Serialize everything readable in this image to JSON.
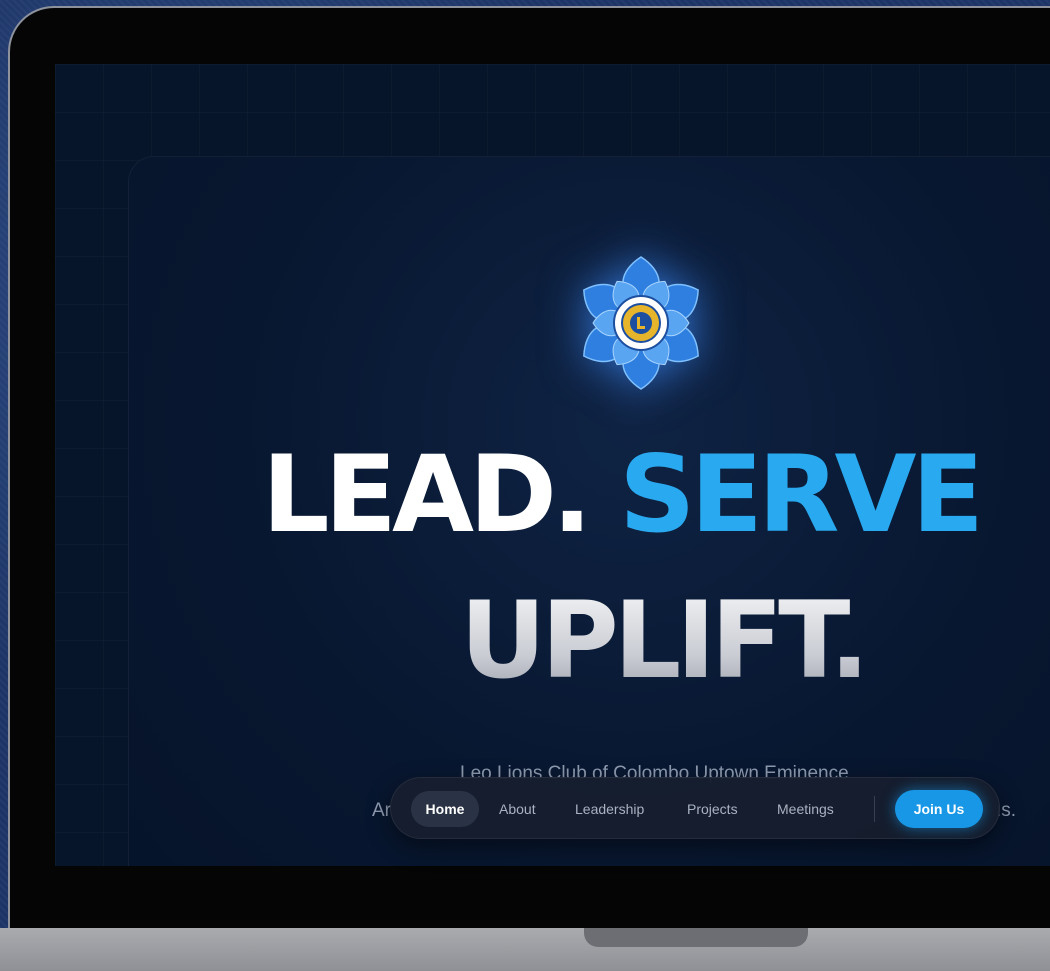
{
  "site": {
    "logo_icon": "leo-lions-club-logo-icon",
    "headline": {
      "word1": "LEAD.",
      "word2": "SERVE",
      "word3": "UPLIFT."
    },
    "subtitle": "Leo Lions Club of Colombo Uptown Eminence",
    "tagline_left": "Ar",
    "tagline_right": "ıs.",
    "accent_color": "#29a9f0"
  },
  "nav": {
    "items": [
      {
        "label": "Home",
        "active": true
      },
      {
        "label": "About"
      },
      {
        "label": "Leadership"
      },
      {
        "label": "Projects"
      },
      {
        "label": "Meetings"
      }
    ],
    "join_label": "Join Us"
  }
}
